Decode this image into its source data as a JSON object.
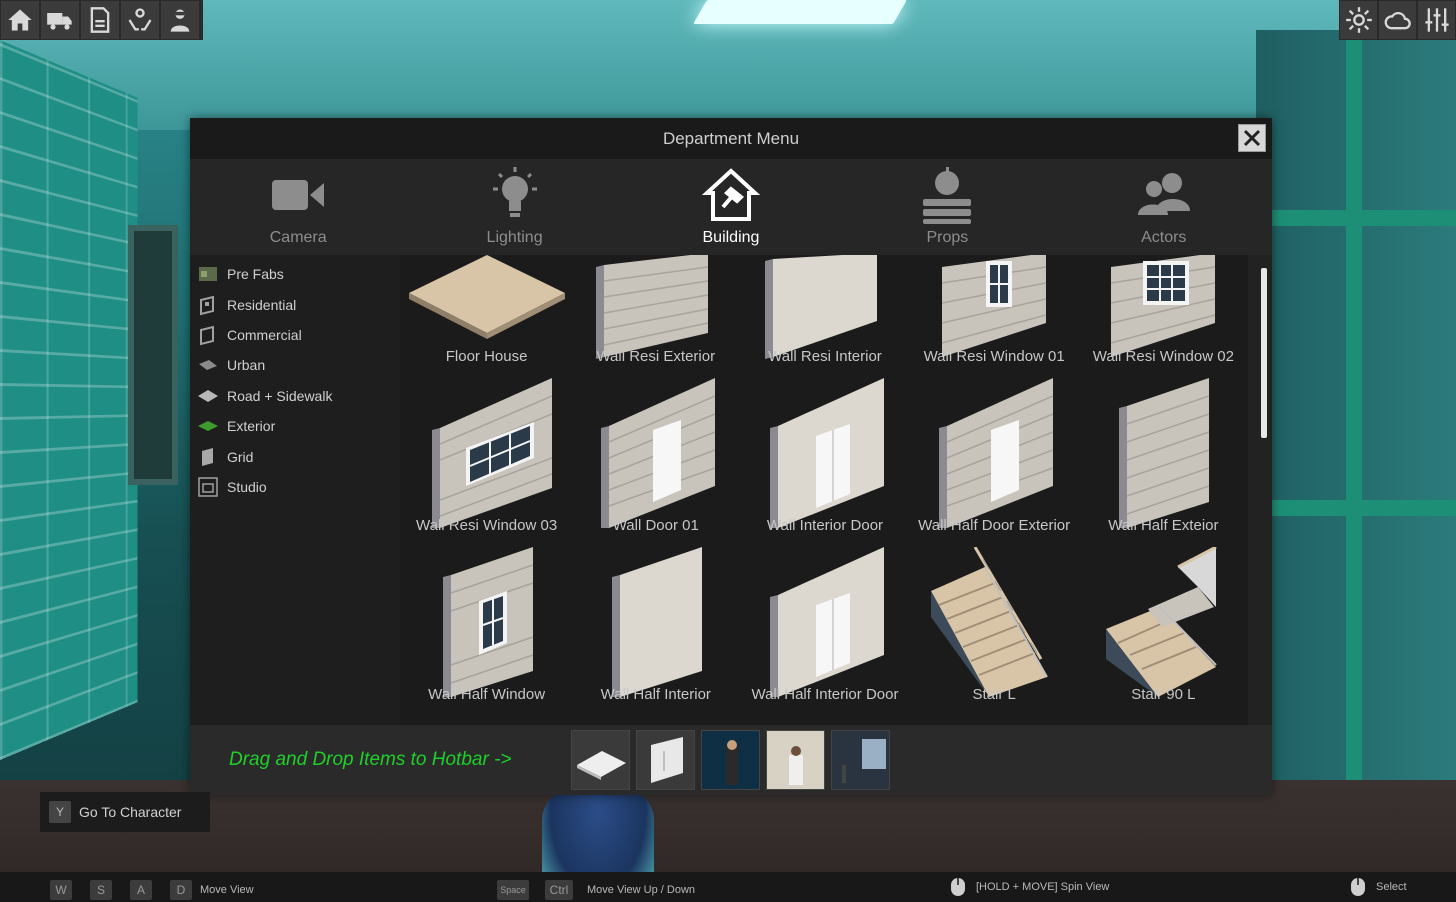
{
  "top_toolbar_left": {
    "buttons": [
      {
        "icon": "home-icon"
      },
      {
        "icon": "truck-icon"
      },
      {
        "icon": "document-icon"
      },
      {
        "icon": "hands-icon"
      },
      {
        "icon": "vr-person-icon"
      }
    ]
  },
  "top_toolbar_right": {
    "buttons": [
      {
        "icon": "sun-icon"
      },
      {
        "icon": "cloud-icon"
      },
      {
        "icon": "sliders-icon"
      }
    ]
  },
  "department_menu": {
    "title": "Department Menu",
    "tabs": [
      {
        "label": "Camera",
        "icon": "camera-icon",
        "active": false
      },
      {
        "label": "Lighting",
        "icon": "lightbulb-icon",
        "active": false
      },
      {
        "label": "Building",
        "icon": "house-hammer-icon",
        "active": true
      },
      {
        "label": "Props",
        "icon": "apple-books-icon",
        "active": false
      },
      {
        "label": "Actors",
        "icon": "people-icon",
        "active": false
      }
    ],
    "sidebar": [
      {
        "label": "Pre Fabs",
        "icon": "prefabs-icon"
      },
      {
        "label": "Residential",
        "icon": "residential-icon"
      },
      {
        "label": "Commercial",
        "icon": "commercial-icon"
      },
      {
        "label": "Urban",
        "icon": "urban-icon"
      },
      {
        "label": "Road + Sidewalk",
        "icon": "road-icon"
      },
      {
        "label": "Exterior",
        "icon": "exterior-icon"
      },
      {
        "label": "Grid",
        "icon": "grid-icon"
      },
      {
        "label": "Studio",
        "icon": "studio-icon"
      }
    ],
    "items": [
      {
        "label": "Floor House",
        "kind": "floor"
      },
      {
        "label": "Wall Resi Exterior",
        "kind": "wall-siding"
      },
      {
        "label": "Wall Resi Interior",
        "kind": "wall-plain"
      },
      {
        "label": "Wall Resi Window 01",
        "kind": "wall-window-small"
      },
      {
        "label": "Wall Resi Window 02",
        "kind": "wall-window-large"
      },
      {
        "label": "Wall Resi Window 03",
        "kind": "wall-window-wide"
      },
      {
        "label": "Wall Door 01",
        "kind": "wall-door"
      },
      {
        "label": "Wall Interior Door",
        "kind": "wall-interior-door"
      },
      {
        "label": "Wall Half Door Exterior",
        "kind": "wall-door"
      },
      {
        "label": "Wall Half Exteior",
        "kind": "wall-siding-tall"
      },
      {
        "label": "Wall Half Window",
        "kind": "wall-window-half"
      },
      {
        "label": "Wall Half Interior",
        "kind": "wall-plain-tall"
      },
      {
        "label": "Wall Half Interior Door",
        "kind": "wall-interior-door"
      },
      {
        "label": "Stair L",
        "kind": "stair"
      },
      {
        "label": "Stair 90 L",
        "kind": "stair-90"
      }
    ],
    "hotbar": {
      "hint": "Drag and Drop Items to Hotbar ->",
      "slots": [
        "floor-thumb",
        "wall-thumb",
        "scene-thumb-1",
        "scene-thumb-2",
        "scene-thumb-3"
      ]
    }
  },
  "go_to_character": {
    "key": "Y",
    "label": "Go To Character"
  },
  "bottom_bar": {
    "keys_move": [
      "W",
      "S",
      "A",
      "D"
    ],
    "move_view": "Move View",
    "key_space": "Space",
    "key_ctrl": "Ctrl",
    "move_updown": "Move View Up / Down",
    "spin_view": "[HOLD + MOVE] Spin View",
    "select": "Select"
  },
  "colors": {
    "hint_green": "#1fcf2a",
    "panel_bg": "#222222",
    "active_tab": "#ffffff",
    "inactive_tab": "#8d8d8d"
  }
}
